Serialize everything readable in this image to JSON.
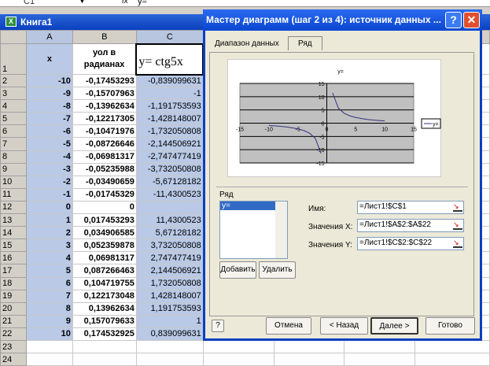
{
  "formula_bar": {
    "name_box": "C1",
    "fx": "fx",
    "value": "y="
  },
  "workbook": {
    "title": "Книга1",
    "columns": [
      "A",
      "B",
      "C"
    ],
    "header_row": {
      "a": "x",
      "b": "уол в радианах",
      "c": "y= ctg5x"
    },
    "rows": [
      [
        "2",
        "-10",
        "-0,17453293",
        "-0,839099631"
      ],
      [
        "3",
        "-9",
        "-0,15707963",
        "-1"
      ],
      [
        "4",
        "-8",
        "-0,13962634",
        "-1,191753593"
      ],
      [
        "5",
        "-7",
        "-0,12217305",
        "-1,428148007"
      ],
      [
        "6",
        "-6",
        "-0,10471976",
        "-1,732050808"
      ],
      [
        "7",
        "-5",
        "-0,08726646",
        "-2,144506921"
      ],
      [
        "8",
        "-4",
        "-0,06981317",
        "-2,747477419"
      ],
      [
        "9",
        "-3",
        "-0,05235988",
        "-3,732050808"
      ],
      [
        "10",
        "-2",
        "-0,03490659",
        "-5,67128182"
      ],
      [
        "11",
        "-1",
        "-0,01745329",
        "-11,4300523"
      ],
      [
        "12",
        "0",
        "0",
        ""
      ],
      [
        "13",
        "1",
        "0,017453293",
        "11,4300523"
      ],
      [
        "14",
        "2",
        "0,034906585",
        "5,67128182"
      ],
      [
        "15",
        "3",
        "0,052359878",
        "3,732050808"
      ],
      [
        "16",
        "4",
        "0,06981317",
        "2,747477419"
      ],
      [
        "17",
        "5",
        "0,087266463",
        "2,144506921"
      ],
      [
        "18",
        "6",
        "0,104719755",
        "1,732050808"
      ],
      [
        "19",
        "7",
        "0,122173048",
        "1,428148007"
      ],
      [
        "20",
        "8",
        "0,13962634",
        "1,191753593"
      ],
      [
        "21",
        "9",
        "0,157079633",
        "1"
      ],
      [
        "22",
        "10",
        "0,174532925",
        "0,839099631"
      ],
      [
        "23",
        "",
        "",
        ""
      ],
      [
        "24",
        "",
        "",
        ""
      ]
    ]
  },
  "dialog": {
    "title": "Мастер диаграмм (шаг 2 из 4): источник данных ...",
    "help": "?",
    "close": "✕",
    "tabs": [
      "Диапазон данных",
      "Ряд"
    ],
    "series_label": "Ряд",
    "series_items": [
      "y="
    ],
    "name_label": "Имя:",
    "name_value": "=Лист1!$C$1",
    "x_label": "Значения X:",
    "x_value": "=Лист1!$A$2:$A$22",
    "y_label": "Значения Y:",
    "y_value": "=Лист1!$C$2:$C$22",
    "add": "Добавить",
    "remove": "Удалить",
    "cancel": "Отмена",
    "back": "< Назад",
    "next": "Далее >",
    "finish": "Готово",
    "help_icon": "?"
  },
  "chart_data": {
    "type": "scatter",
    "title": "y=",
    "legend": "y=",
    "legend_position": "right",
    "xlim": [
      -15,
      15
    ],
    "ylim": [
      -15,
      15
    ],
    "xticks": [
      "-15",
      "-10",
      "-5",
      "0",
      "5",
      "10",
      "15"
    ],
    "yticks": [
      "15",
      "10",
      "5",
      "0",
      "-5",
      "-10",
      "-15"
    ],
    "series": [
      {
        "name": "y=",
        "x": [
          -10,
          -9,
          -8,
          -7,
          -6,
          -5,
          -4,
          -3,
          -2,
          -1,
          1,
          2,
          3,
          4,
          5,
          6,
          7,
          8,
          9,
          10
        ],
        "y": [
          -0.839,
          -1,
          -1.192,
          -1.428,
          -1.732,
          -2.145,
          -2.747,
          -3.732,
          -5.671,
          -11.43,
          11.43,
          5.671,
          3.732,
          2.747,
          2.145,
          1.732,
          1.428,
          1.192,
          1,
          0.839
        ]
      }
    ]
  }
}
